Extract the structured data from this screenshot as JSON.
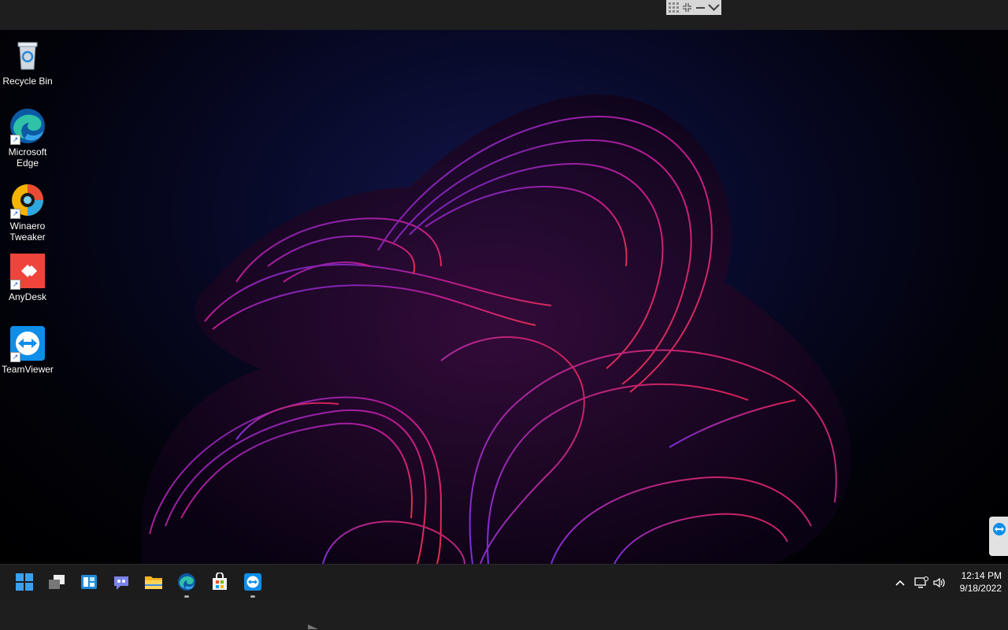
{
  "desktop_icons": [
    {
      "label": "Recycle Bin",
      "icon": "recycle-bin-icon"
    },
    {
      "label": "Microsoft Edge",
      "icon": "edge-icon"
    },
    {
      "label": "Winaero Tweaker",
      "icon": "winaero-tweaker-icon"
    },
    {
      "label": "AnyDesk",
      "icon": "anydesk-icon"
    },
    {
      "label": "TeamViewer",
      "icon": "teamviewer-icon"
    }
  ],
  "taskbar": {
    "apps": [
      "start-icon",
      "task-view-icon",
      "widgets-icon",
      "teams-chat-icon",
      "file-explorer-icon",
      "edge-icon",
      "microsoft-store-icon",
      "teamviewer-icon"
    ],
    "tray_icons": [
      "chevron-up-icon",
      "network-icon",
      "volume-icon"
    ],
    "time": "12:14 PM",
    "date": "9/18/2022"
  },
  "colors": {
    "taskbar": "#1c1c1c",
    "accent_blue": "#0078d4",
    "anydesk_red": "#ef443b",
    "wallpaper_magenta": "#c01a8c",
    "wallpaper_purple": "#6a2bd8"
  }
}
